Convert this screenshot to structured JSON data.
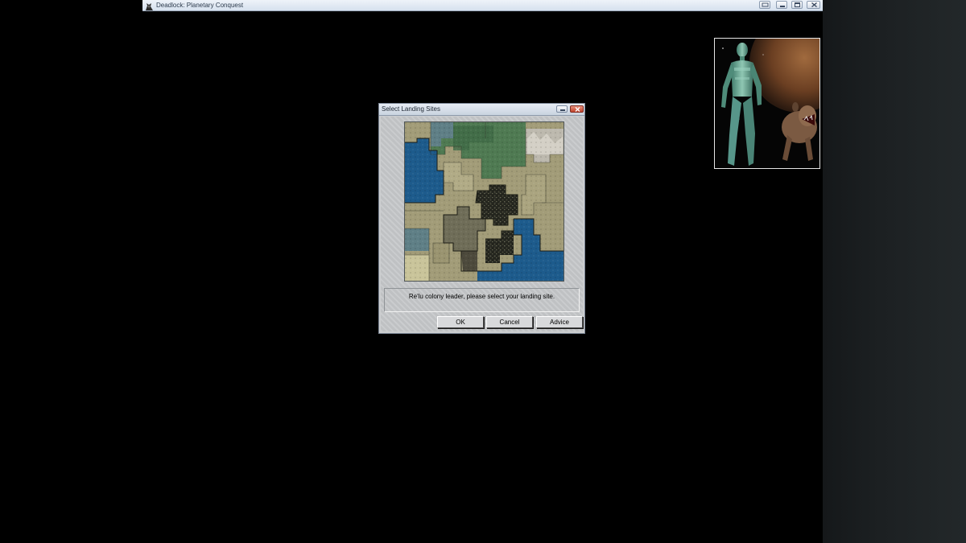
{
  "window": {
    "title": "Deadlock: Planetary Conquest",
    "icon": "app-icon"
  },
  "dialog": {
    "title": "Select Landing Sites",
    "message": "Re'lu colony leader, please select your landing site.",
    "buttons": {
      "ok": "OK",
      "cancel": "Cancel",
      "advice": "Advice"
    }
  },
  "colors": {
    "ocean": "#1d5b8c",
    "plains": "#a29c78",
    "forest": "#4f7a52",
    "swamp": "#6f7a5f",
    "desert": "#c9c49a",
    "dark_terrain": "#3d3b32",
    "close_button": "#c0432c"
  }
}
